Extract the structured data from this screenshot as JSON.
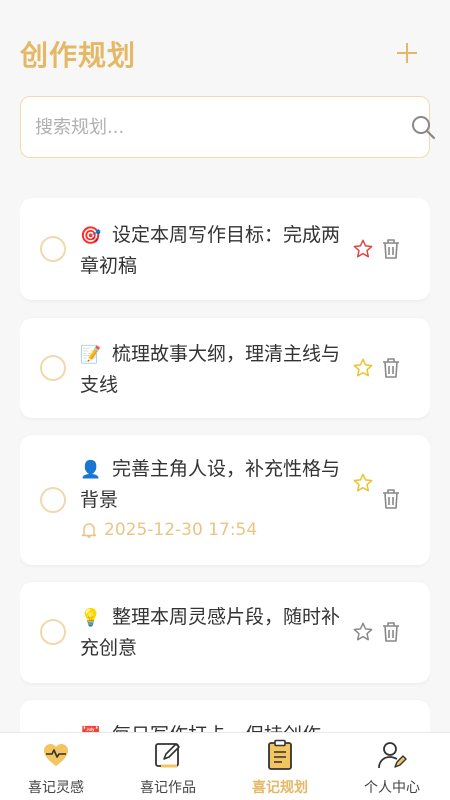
{
  "header": {
    "title": "创作规划",
    "add_icon": "plus-icon"
  },
  "search": {
    "placeholder": "搜索规划...",
    "value": "",
    "icon": "search-icon"
  },
  "tasks": [
    {
      "emoji": "🎯",
      "text": "设定本周写作目标：完成两章初稿",
      "reminder": "",
      "starred": true,
      "star_color": "#e04444"
    },
    {
      "emoji": "📝",
      "text": "梳理故事大纲，理清主线与支线",
      "reminder": "",
      "starred": true,
      "star_color": "#f0c02a"
    },
    {
      "emoji": "👤",
      "text": "完善主角人设，补充性格与背景",
      "reminder": "2025-12-30 17:54",
      "starred": true,
      "star_color": "#f0c02a"
    },
    {
      "emoji": "💡",
      "text": "整理本周灵感片段，随时补充创意",
      "reminder": "",
      "starred": false,
      "star_color": "#888888"
    },
    {
      "emoji": "📅",
      "text": "每日写作打卡，保持创作",
      "reminder": "",
      "starred": false,
      "star_color": "#888888"
    }
  ],
  "tabs": [
    {
      "label": "喜记灵感",
      "icon": "heartbeat-icon",
      "active": false
    },
    {
      "label": "喜记作品",
      "icon": "edit-icon",
      "active": false
    },
    {
      "label": "喜记规划",
      "icon": "clipboard-icon",
      "active": true
    },
    {
      "label": "个人中心",
      "icon": "user-icon",
      "active": false
    }
  ],
  "colors": {
    "accent": "#e5b865",
    "background": "#f7f7f8",
    "card": "#ffffff"
  }
}
